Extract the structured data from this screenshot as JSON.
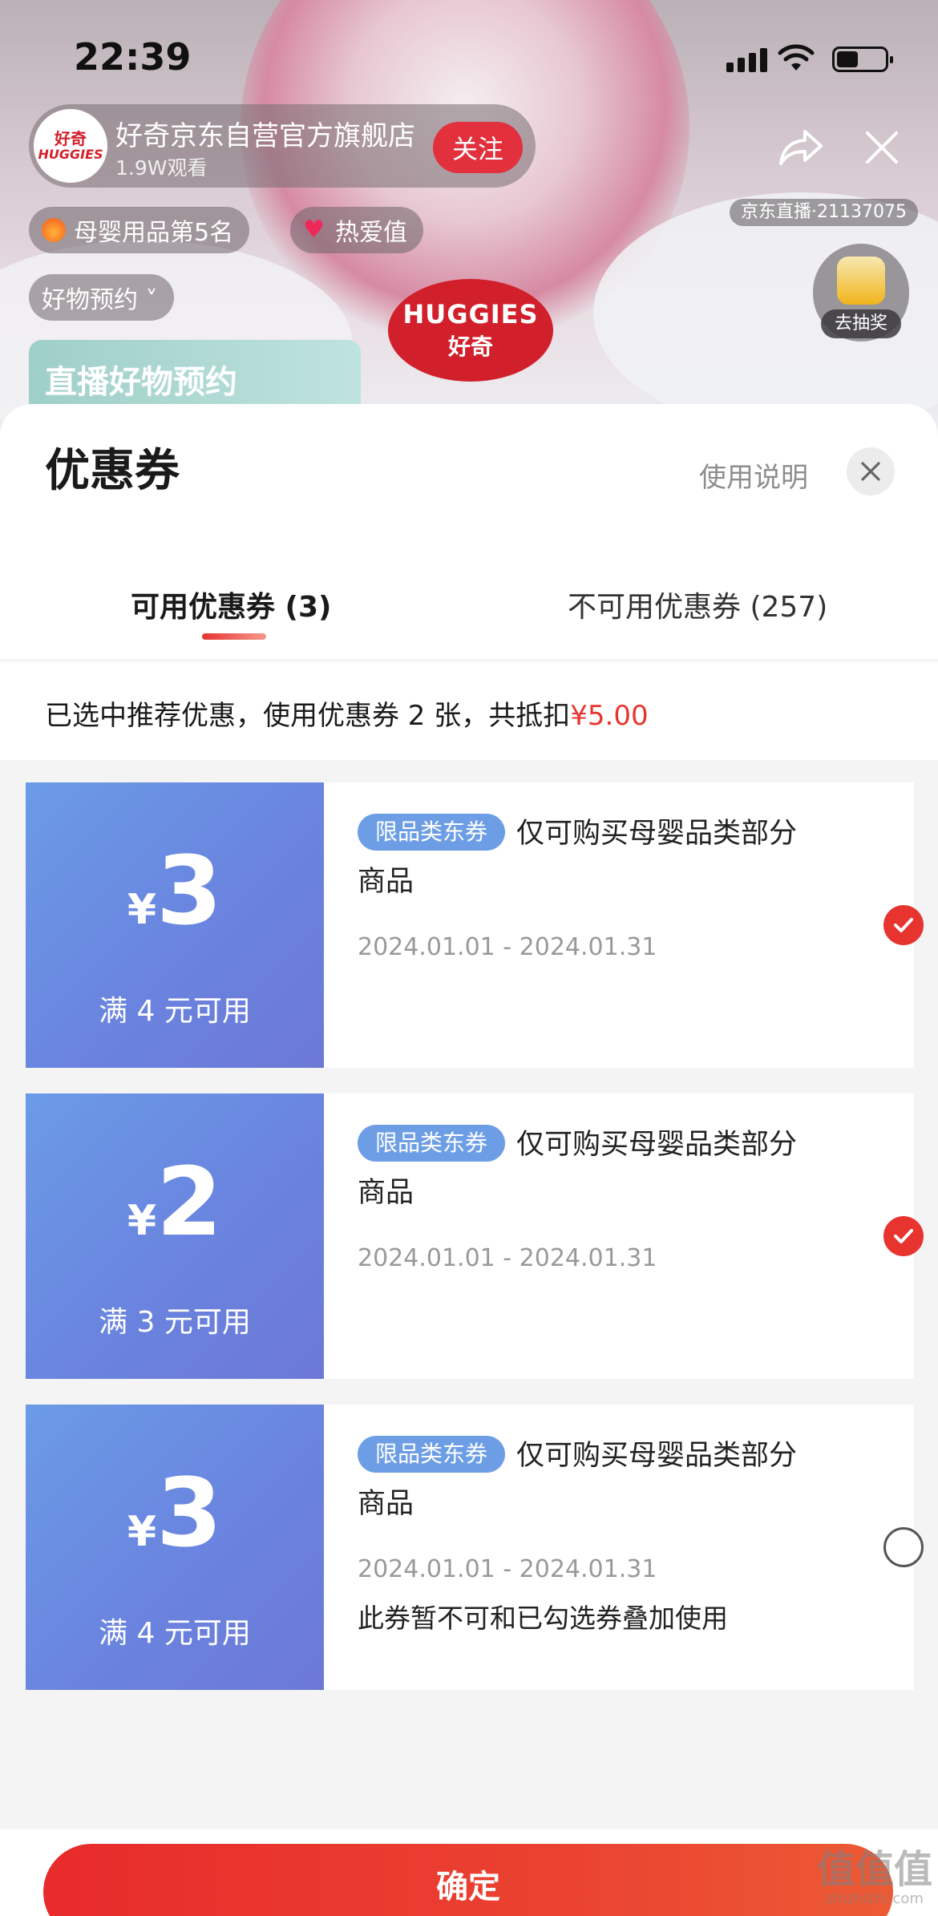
{
  "status_bar": {
    "time": "22:39"
  },
  "live": {
    "shop_name": "好奇京东自营官方旗舰店",
    "viewers": "1.9W观看",
    "follow_label": "关注",
    "logo_text_top": "好奇",
    "logo_text_bottom": "HUGGIES",
    "live_id": "京东直播·21137075",
    "tags": {
      "ranking": "母婴用品第5名",
      "love": "热爱值",
      "reserve": "好物预约 ˅"
    },
    "lottery_label": "去抽奖",
    "brand_logo_top": "HUGGIES",
    "brand_logo_bottom": "好奇",
    "promo_banner": "直播好物预约",
    "icons": {
      "share": "share-icon",
      "close": "close-icon"
    }
  },
  "sheet": {
    "title": "优惠券",
    "help_link": "使用说明",
    "tabs": [
      {
        "label": "可用优惠券 (3)",
        "active": true
      },
      {
        "label": "不可用优惠券 (257)",
        "active": false
      }
    ],
    "summary_prefix": "已选中推荐优惠，使用优惠券 2 张，共抵扣",
    "summary_amount": "¥5.00",
    "coupons": [
      {
        "currency": "¥",
        "amount": "3",
        "threshold": "满 4 元可用",
        "badge": "限品类东券",
        "description": "仅可购买母婴品类部分商品",
        "date": "2024.01.01 - 2024.01.31",
        "note": "",
        "selected": true
      },
      {
        "currency": "¥",
        "amount": "2",
        "threshold": "满 3 元可用",
        "badge": "限品类东券",
        "description": "仅可购买母婴品类部分商品",
        "date": "2024.01.01 - 2024.01.31",
        "note": "",
        "selected": true
      },
      {
        "currency": "¥",
        "amount": "3",
        "threshold": "满 4 元可用",
        "badge": "限品类东券",
        "description": "仅可购买母婴品类部分商品",
        "date": "2024.01.01 - 2024.01.31",
        "note": "此券暂不可和已勾选券叠加使用",
        "selected": false
      }
    ],
    "confirm_label": "确定"
  },
  "watermark": {
    "logo": "值值值",
    "site": "zhizhizhi.com"
  },
  "colors": {
    "accent": "#e8342f",
    "coupon_blue": "#6a84df",
    "badge_blue": "#6d9ee5"
  }
}
